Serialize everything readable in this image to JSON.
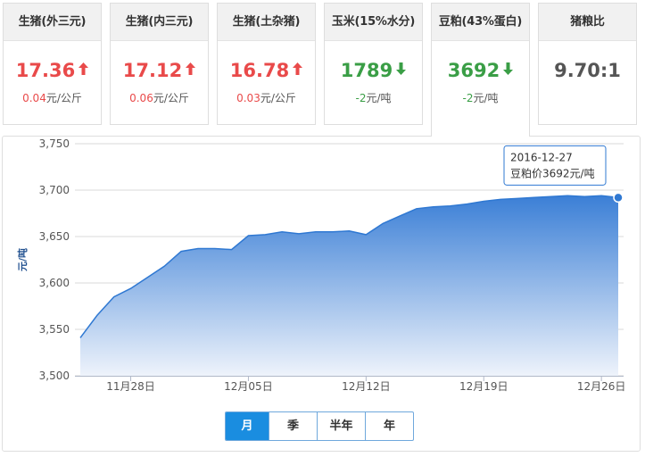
{
  "cards": [
    {
      "title": "生猪(外三元)",
      "value": "17.36",
      "trend": "up",
      "change_num": "0.04",
      "change_unit": "元/公斤"
    },
    {
      "title": "生猪(内三元)",
      "value": "17.12",
      "trend": "up",
      "change_num": "0.06",
      "change_unit": "元/公斤"
    },
    {
      "title": "生猪(土杂猪)",
      "value": "16.78",
      "trend": "up",
      "change_num": "0.03",
      "change_unit": "元/公斤"
    },
    {
      "title": "玉米(15%水分)",
      "value": "1789",
      "trend": "down",
      "change_num": "-2",
      "change_unit": "元/吨"
    },
    {
      "title": "豆粕(43%蛋白)",
      "value": "3692",
      "trend": "down",
      "change_num": "-2",
      "change_unit": "元/吨",
      "active": true
    },
    {
      "title": "猪粮比",
      "value": "9.70:1",
      "trend": "flat",
      "change_num": "",
      "change_unit": ""
    }
  ],
  "colors": {
    "up": "#e94a4a",
    "down": "#3a9e46",
    "accent": "#1a8de0",
    "area_top": "#3b7fd6",
    "area_bottom": "#eef3fb"
  },
  "chart_data": {
    "type": "area",
    "ylabel": "元/吨",
    "ylim": [
      3500,
      3750
    ],
    "y_ticks": [
      "3,500",
      "3,550",
      "3,600",
      "3,650",
      "3,700",
      "3,750"
    ],
    "y_tick_values": [
      3500,
      3550,
      3600,
      3650,
      3700,
      3750
    ],
    "x_tick_labels": [
      "11月28日",
      "12月05日",
      "12月12日",
      "12月19日",
      "12月26日"
    ],
    "x_tick_days": [
      3,
      10,
      17,
      24,
      31
    ],
    "x_start": "2016-11-25",
    "x_end": "2016-12-27",
    "grid": true,
    "series": [
      {
        "name": "豆粕价",
        "x": [
          "2016-11-25",
          "2016-11-26",
          "2016-11-27",
          "2016-11-28",
          "2016-11-29",
          "2016-11-30",
          "2016-12-01",
          "2016-12-02",
          "2016-12-03",
          "2016-12-04",
          "2016-12-05",
          "2016-12-06",
          "2016-12-07",
          "2016-12-08",
          "2016-12-09",
          "2016-12-10",
          "2016-12-11",
          "2016-12-12",
          "2016-12-13",
          "2016-12-14",
          "2016-12-15",
          "2016-12-16",
          "2016-12-17",
          "2016-12-18",
          "2016-12-19",
          "2016-12-20",
          "2016-12-21",
          "2016-12-22",
          "2016-12-23",
          "2016-12-24",
          "2016-12-25",
          "2016-12-26",
          "2016-12-27"
        ],
        "values": [
          3541,
          3565,
          3585,
          3594,
          3606,
          3618,
          3634,
          3637,
          3637,
          3636,
          3651,
          3652,
          3655,
          3653,
          3655,
          3655,
          3656,
          3652,
          3664,
          3672,
          3680,
          3682,
          3683,
          3685,
          3688,
          3690,
          3691,
          3692,
          3693,
          3694,
          3693,
          3694,
          3692
        ]
      }
    ]
  },
  "tooltip": {
    "date": "2016-12-27",
    "text": "豆粕价3692元/吨"
  },
  "range_tabs": [
    {
      "label": "月",
      "active": true
    },
    {
      "label": "季",
      "active": false
    },
    {
      "label": "半年",
      "active": false
    },
    {
      "label": "年",
      "active": false
    }
  ]
}
